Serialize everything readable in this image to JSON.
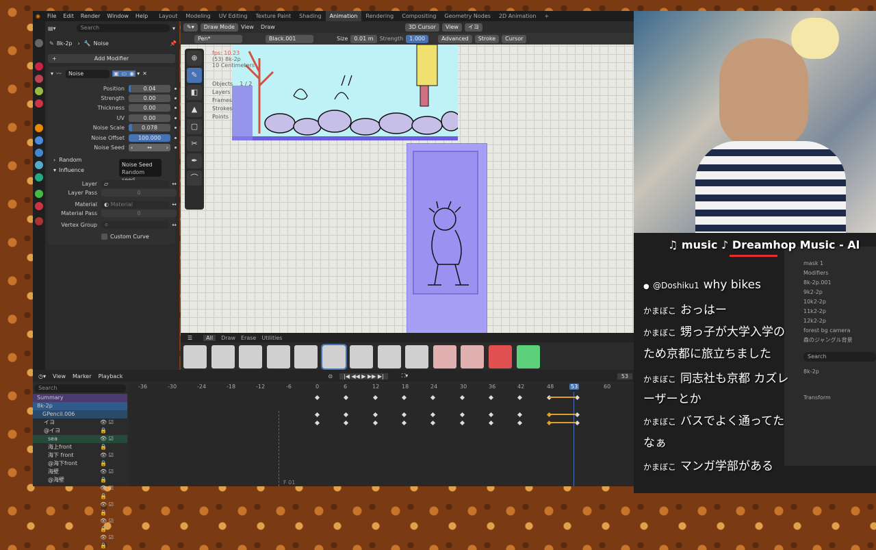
{
  "menubar": {
    "items": [
      "File",
      "Edit",
      "Render",
      "Window",
      "Help"
    ],
    "workspaces": [
      "Layout",
      "Modeling",
      "UV Editing",
      "Texture Paint",
      "Shading",
      "Animation",
      "Rendering",
      "Compositing",
      "Geometry Nodes",
      "2D Animation"
    ],
    "active": "Animation"
  },
  "props": {
    "search_placeholder": "Search",
    "object": "8k-2p",
    "modifier_name": "Noise",
    "add_modifier": "Add Modifier",
    "mod_title": "Noise",
    "fields": [
      {
        "label": "Position",
        "value": "0.04",
        "fill": 0.05
      },
      {
        "label": "Strength",
        "value": "0.00",
        "fill": 0
      },
      {
        "label": "Thickness",
        "value": "0.00",
        "fill": 0
      },
      {
        "label": "UV",
        "value": "0.00",
        "fill": 0
      },
      {
        "label": "Noise Scale",
        "value": "0.078",
        "fill": 0.08
      },
      {
        "label": "Noise Offset",
        "value": "100.000",
        "fill": 1
      },
      {
        "label": "Noise Seed",
        "value": "",
        "fill": 0
      }
    ],
    "tooltip_title": "Noise Seed",
    "tooltip_desc": "Random seed.",
    "random": "Random",
    "influence": "Influence",
    "layer": "Layer",
    "layer_pass": "Layer Pass",
    "layer_pass_val": "0",
    "material": "Material",
    "material_ph": "Material",
    "material_pass": "Material Pass",
    "material_pass_val": "0",
    "vertex_group": "Vertex Group",
    "custom_curve": "Custom Curve"
  },
  "viewport": {
    "mode": "Draw Mode",
    "view": "View",
    "draw": "Draw",
    "cursor": "3D Cursor",
    "view2": "View",
    "layer": "イヨ",
    "pen": "Pen*",
    "material": "Black.001",
    "size_label": "Size",
    "size": "0.01 m",
    "strength_label": "Strength",
    "strength": "1.000",
    "advanced": "Advanced",
    "stroke": "Stroke",
    "cursor2": "Cursor",
    "overlay": {
      "fps": "fps: 10.23",
      "frame": "(53) 8k-2p",
      "scale": "10 Centimeters",
      "stats": [
        "Objects",
        "Layers",
        "Frames",
        "Strokes",
        "Points"
      ],
      "objects_val": "1 / 2"
    }
  },
  "brushes": {
    "tabs": [
      "All",
      "Draw",
      "Erase",
      "Utilities"
    ],
    "active": "All"
  },
  "timeline": {
    "view": "View",
    "marker": "Marker",
    "playback": "Playback",
    "search_placeholder": "Search",
    "current_frame": "53",
    "frame_end": "53",
    "ticks": [
      "-36",
      "-30",
      "-24",
      "-18",
      "-12",
      "-6",
      "0",
      "6",
      "12",
      "18",
      "24",
      "30",
      "36",
      "42",
      "48",
      "53",
      "60"
    ],
    "channels": [
      "Summary",
      "8k-2p",
      "GPencil.006",
      "イヨ",
      "@イヨ",
      "sea",
      "海上front",
      "海下 front",
      "@海下front",
      "海壁",
      "@海壁"
    ],
    "status": "F 01"
  },
  "now_playing": "♫ music ♪ Dreamhop Music - Al",
  "chat": [
    {
      "user": "@Doshiku1",
      "text": "why bikes"
    },
    {
      "user": "かまぼこ",
      "text": "おっはー"
    },
    {
      "user": "かまぼこ",
      "text": "甥っ子が大学入学の"
    },
    {
      "user": "",
      "text": "ため京都に旅立ちました"
    },
    {
      "user": "かまぼこ",
      "text": "同志社も京都 カズレ"
    },
    {
      "user": "",
      "text": "ーザーとか"
    },
    {
      "user": "かまぼこ",
      "text": "バスでよく通ってた"
    },
    {
      "user": "",
      "text": "なぁ"
    },
    {
      "user": "かまぼこ",
      "text": "マンガ学部がある"
    }
  ],
  "outliner": {
    "items": [
      "mask 1",
      "Modifiers",
      "8k-2p.001",
      "9k2-2p",
      "10k2-2p",
      "11k2-2p",
      "12k2-2p",
      "forest bg camera",
      "森のジャングル背景",
      "8k-2p",
      "Transform"
    ],
    "search_placeholder": "Search"
  },
  "colors": {
    "accent": "#4772b3",
    "keyframe_selected": "#e0a030",
    "playhead": "#4772b3"
  }
}
